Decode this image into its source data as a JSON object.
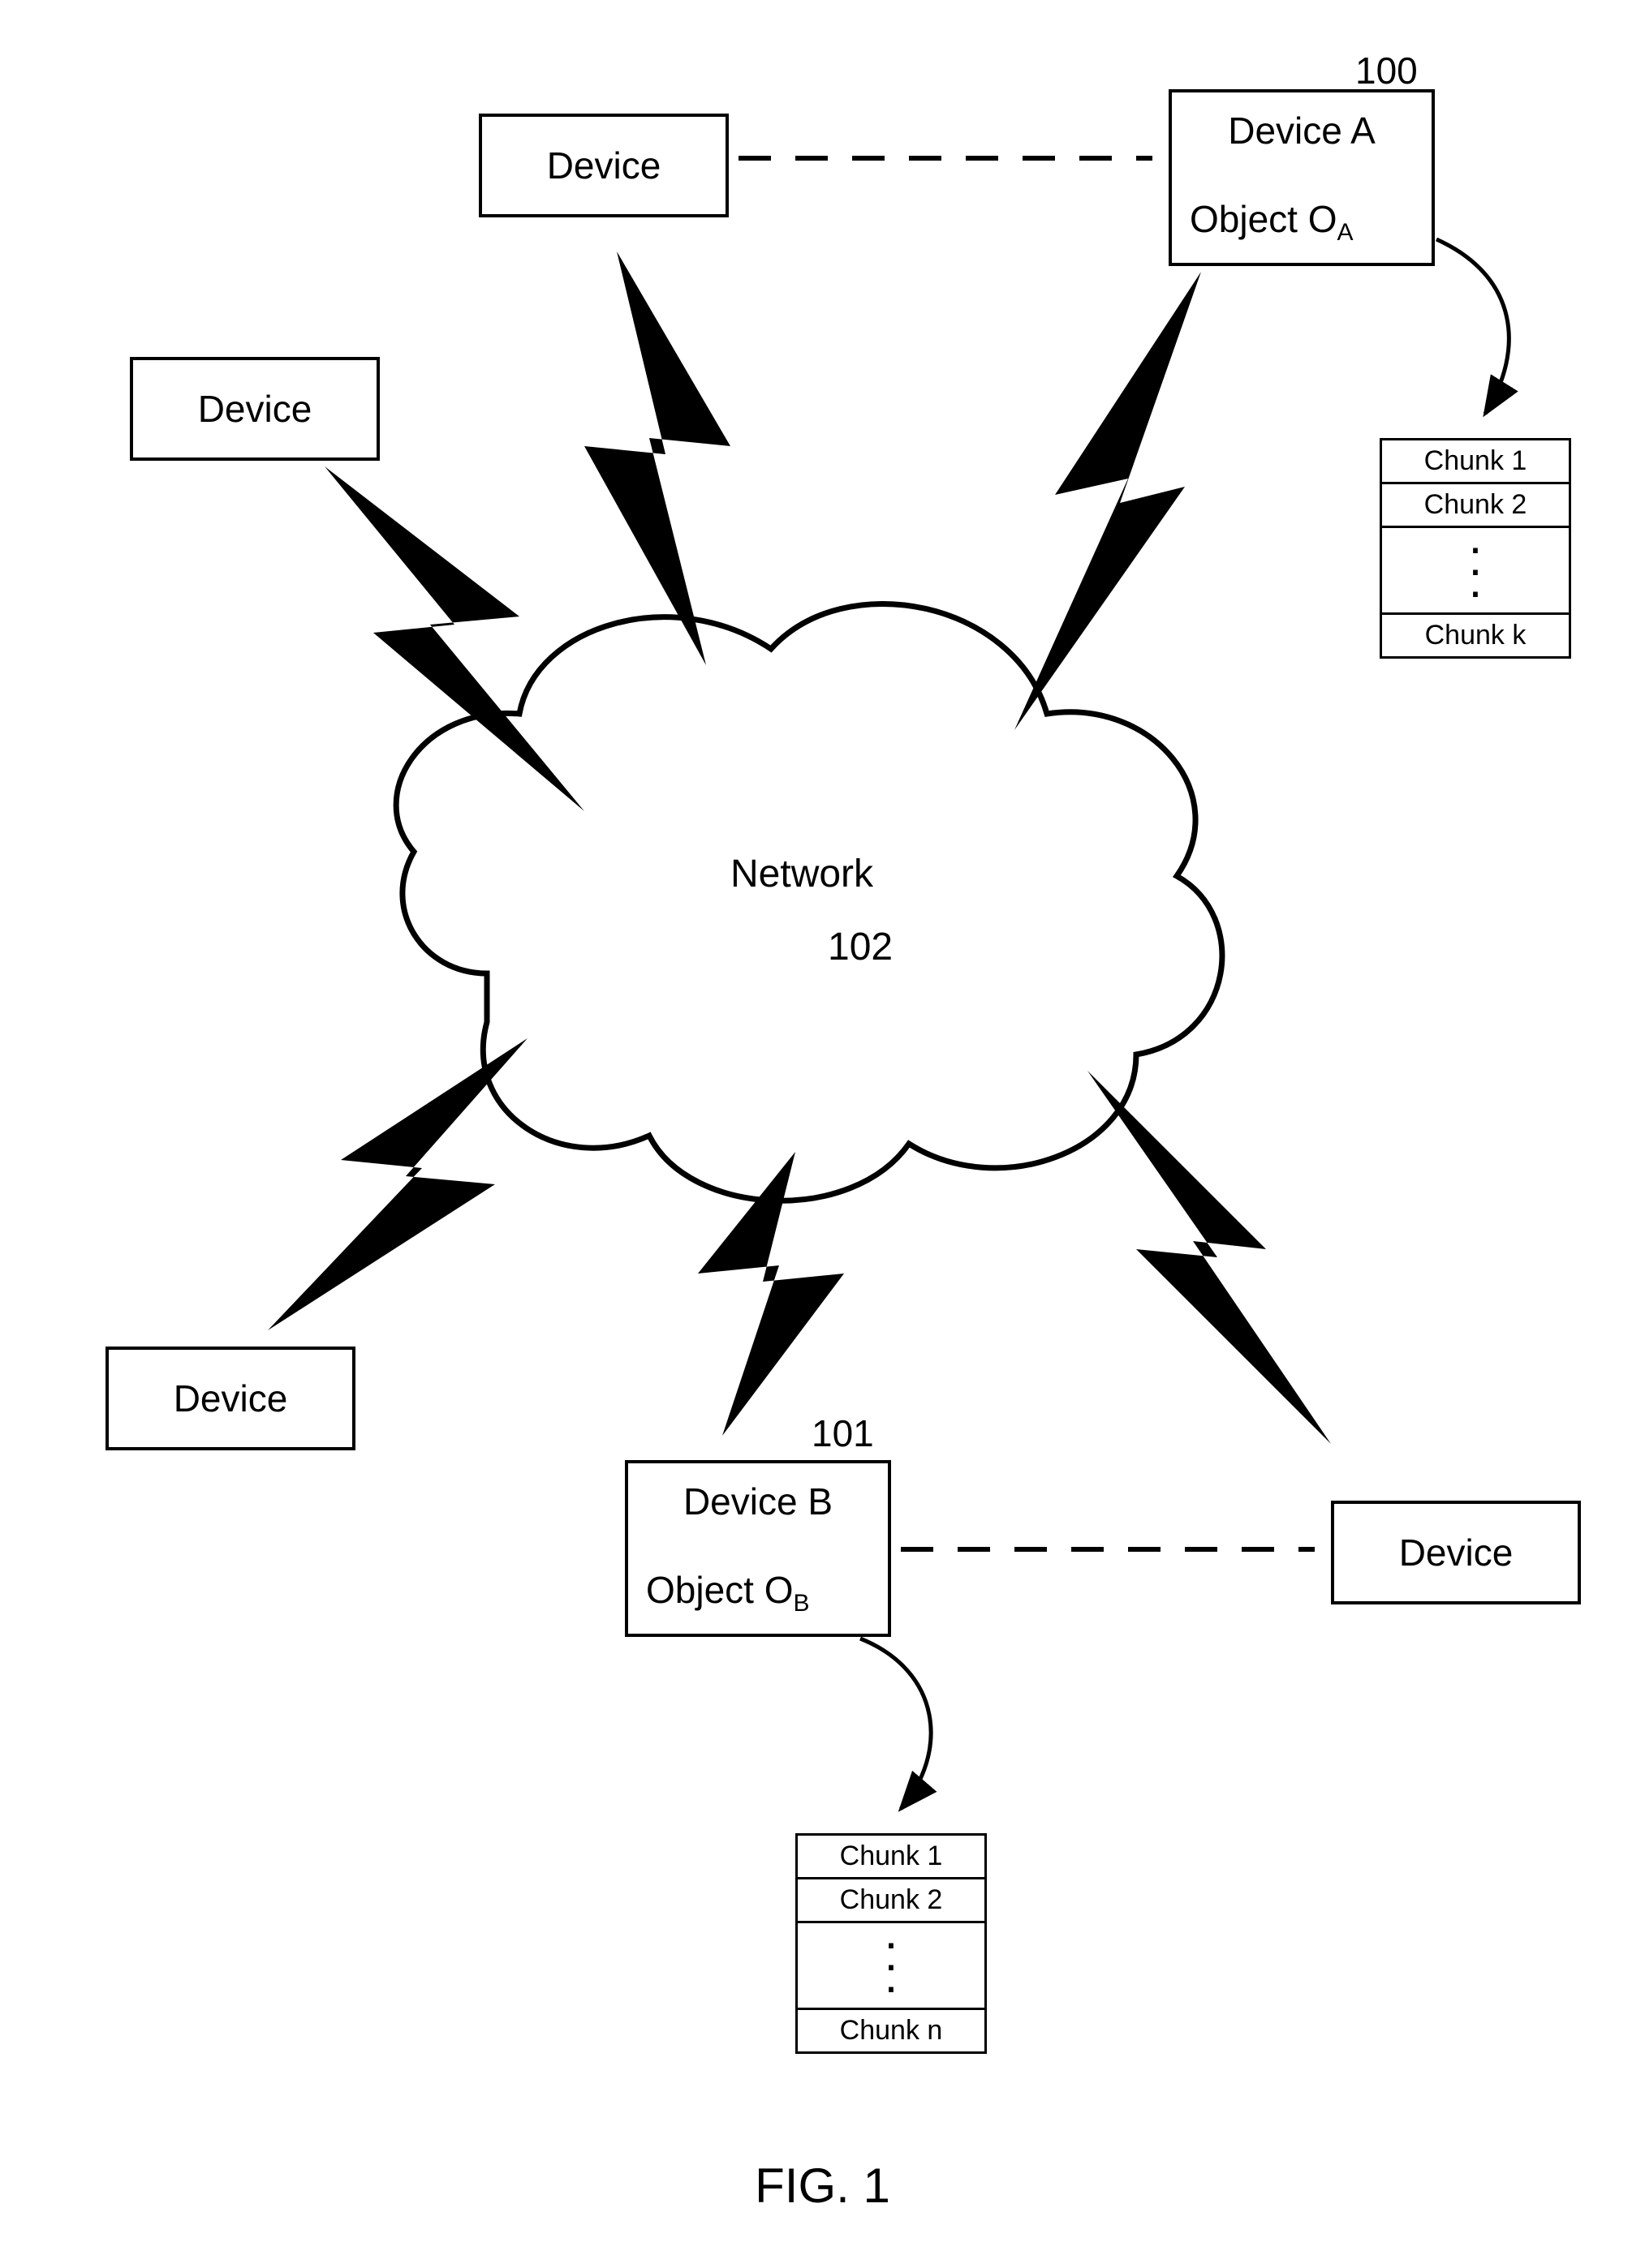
{
  "figure_label": "FIG. 1",
  "network": {
    "label": "Network",
    "ref": "102"
  },
  "devices": {
    "generic_label": "Device",
    "a": {
      "ref": "100",
      "title": "Device A",
      "object_prefix": "Object O",
      "object_sub": "A"
    },
    "b": {
      "ref": "101",
      "title": "Device B",
      "object_prefix": "Object O",
      "object_sub": "B"
    }
  },
  "chunks": {
    "a": {
      "rows": [
        "Chunk 1",
        "Chunk 2"
      ],
      "last": "Chunk k"
    },
    "b": {
      "rows": [
        "Chunk 1",
        "Chunk 2"
      ],
      "last": "Chunk n"
    }
  }
}
